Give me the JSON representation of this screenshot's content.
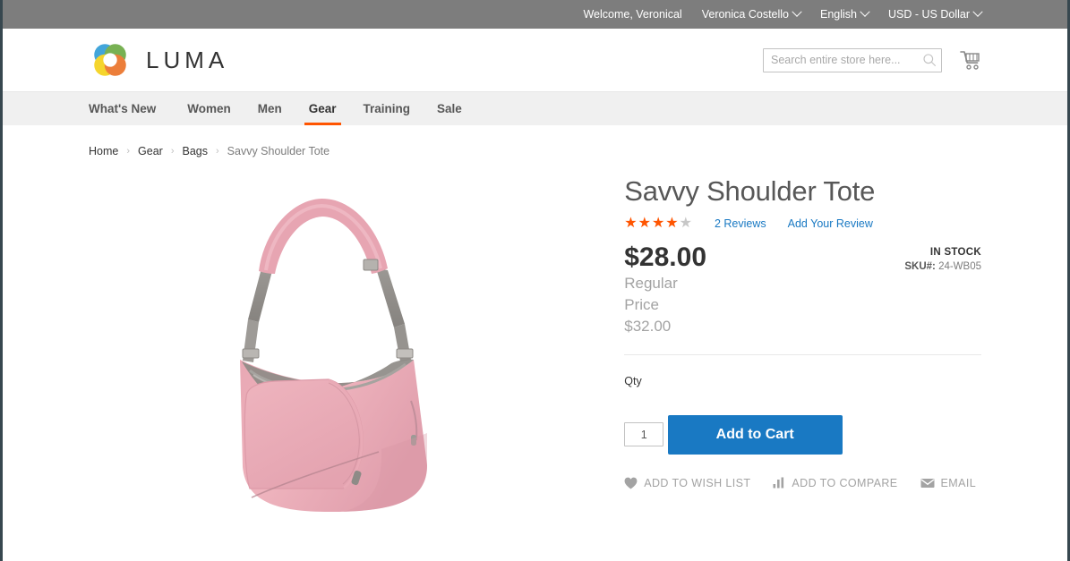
{
  "topbar": {
    "welcome": "Welcome, Veronical",
    "account": "Veronica Costello",
    "language": "English",
    "currency": "USD - US Dollar"
  },
  "header": {
    "logo_text": "LUMA",
    "logo_icon": "luma-flower-logo",
    "search_placeholder": "Search entire store here...",
    "search_value": "",
    "search_icon": "search-icon",
    "cart_icon": "shopping-cart-icon"
  },
  "nav": {
    "items": [
      {
        "label": "What's New",
        "active": false
      },
      {
        "label": "Women",
        "active": false
      },
      {
        "label": "Men",
        "active": false
      },
      {
        "label": "Gear",
        "active": true
      },
      {
        "label": "Training",
        "active": false
      },
      {
        "label": "Sale",
        "active": false
      }
    ],
    "active_underline_color": "#ff5501"
  },
  "breadcrumb": {
    "items": [
      "Home",
      "Gear",
      "Bags",
      "Savvy Shoulder Tote"
    ],
    "separator": "›"
  },
  "product": {
    "title": "Savvy Shoulder Tote",
    "image_alt": "pink-shoulder-tote-bag",
    "rating": {
      "filled": 4,
      "total": 5,
      "star_on_color": "#ff5501",
      "star_off_color": "#c7c7c7",
      "reviews_link": "2 Reviews",
      "add_review_link": "Add Your Review"
    },
    "price": "$28.00",
    "old_price_label": "Regular Price",
    "old_price_value": "$32.00",
    "availability": "IN STOCK",
    "sku_label": "SKU#:",
    "sku_value": "24-WB05",
    "qty_label": "Qty",
    "qty_value": "1",
    "add_to_cart_label": "Add to Cart",
    "add_to_cart_color": "#1979c3",
    "actions": [
      {
        "label": "ADD TO WISH LIST",
        "icon": "heart-icon"
      },
      {
        "label": "ADD TO COMPARE",
        "icon": "bar-chart-icon"
      },
      {
        "label": "EMAIL",
        "icon": "envelope-icon"
      }
    ]
  }
}
